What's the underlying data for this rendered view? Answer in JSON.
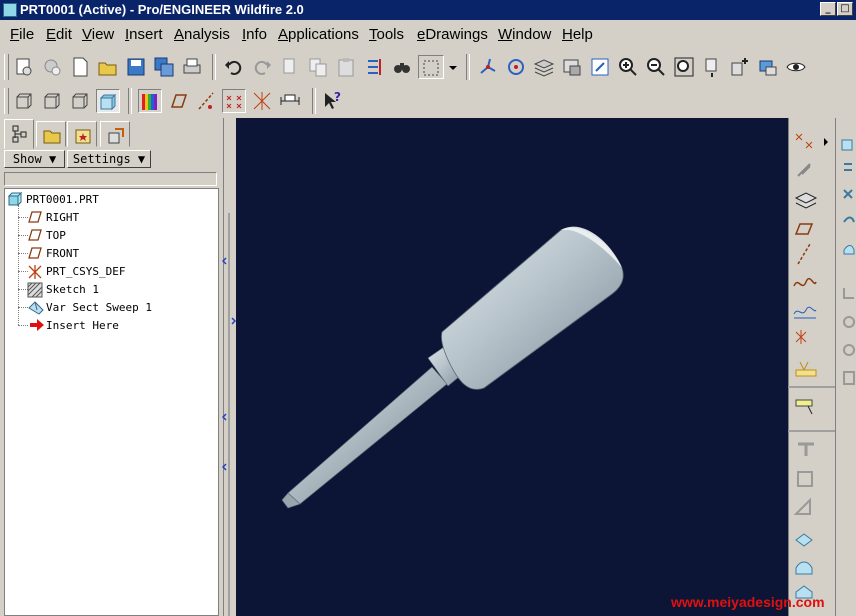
{
  "window": {
    "title": "PRT0001 (Active) - Pro/ENGINEER Wildfire 2.0",
    "minimize_glyph": "_",
    "restore_glyph": "□"
  },
  "menu": [
    "File",
    "Edit",
    "View",
    "Insert",
    "Analysis",
    "Info",
    "Applications",
    "Tools",
    "eDrawings",
    "Window",
    "Help"
  ],
  "model_tree": {
    "show_label": "Show",
    "settings_label": "Settings",
    "root": "PRT0001.PRT",
    "items": [
      {
        "label": "RIGHT",
        "icon": "datum-plane-icon"
      },
      {
        "label": "TOP",
        "icon": "datum-plane-icon"
      },
      {
        "label": "FRONT",
        "icon": "datum-plane-icon"
      },
      {
        "label": "PRT_CSYS_DEF",
        "icon": "coordinate-system-icon"
      },
      {
        "label": "Sketch 1",
        "icon": "sketch-icon"
      },
      {
        "label": "Var Sect Sweep 1",
        "icon": "sweep-feature-icon"
      },
      {
        "label": "Insert Here",
        "icon": "insert-arrow-icon"
      }
    ]
  },
  "colors": {
    "title_bar": "#0a246a",
    "viewport_bg": "#0c1535",
    "model_surface": "#b8c4cc",
    "watermark": "#e01010"
  },
  "watermark": "www.meiyadesign.com"
}
